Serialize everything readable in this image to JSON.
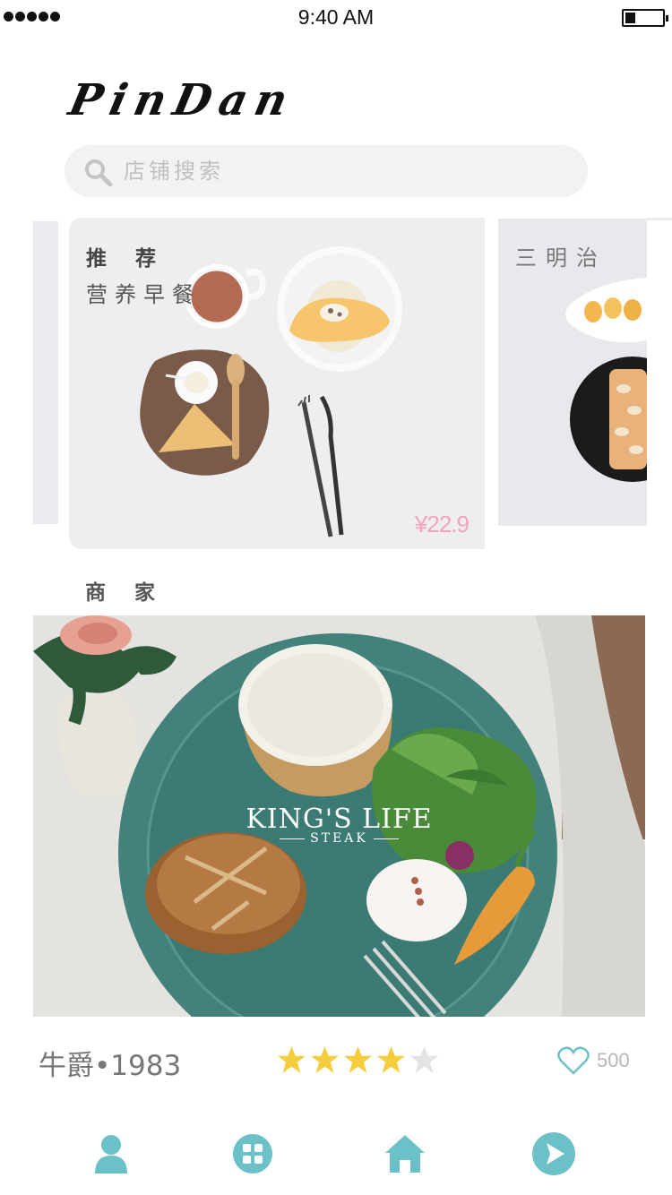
{
  "status_bar": {
    "time": "9:40 AM"
  },
  "app": {
    "logo": "PinDan"
  },
  "search": {
    "placeholder": "店铺搜索",
    "icon": "search-icon"
  },
  "carousel": {
    "featured": {
      "tag": "推 荐",
      "title": "营养早餐",
      "price": "¥22.9"
    },
    "next": {
      "title": "三明治"
    }
  },
  "merchants": {
    "section_title": "商 家",
    "items": [
      {
        "name": "牛爵•1983",
        "brand": "KING'S LIFE",
        "brand_sub": "STEAK",
        "rating": 4,
        "rating_max": 5,
        "likes": "500"
      }
    ]
  },
  "tab_bar": {
    "items": [
      {
        "icon": "user-icon"
      },
      {
        "icon": "grid-icon"
      },
      {
        "icon": "home-icon"
      },
      {
        "icon": "send-icon"
      }
    ]
  },
  "colors": {
    "accent": "#6cc0c7",
    "price": "#f4a2c0",
    "star_on": "#f5cd3d",
    "star_off": "#e3e3e3",
    "search_bg": "#f2f2f2"
  }
}
